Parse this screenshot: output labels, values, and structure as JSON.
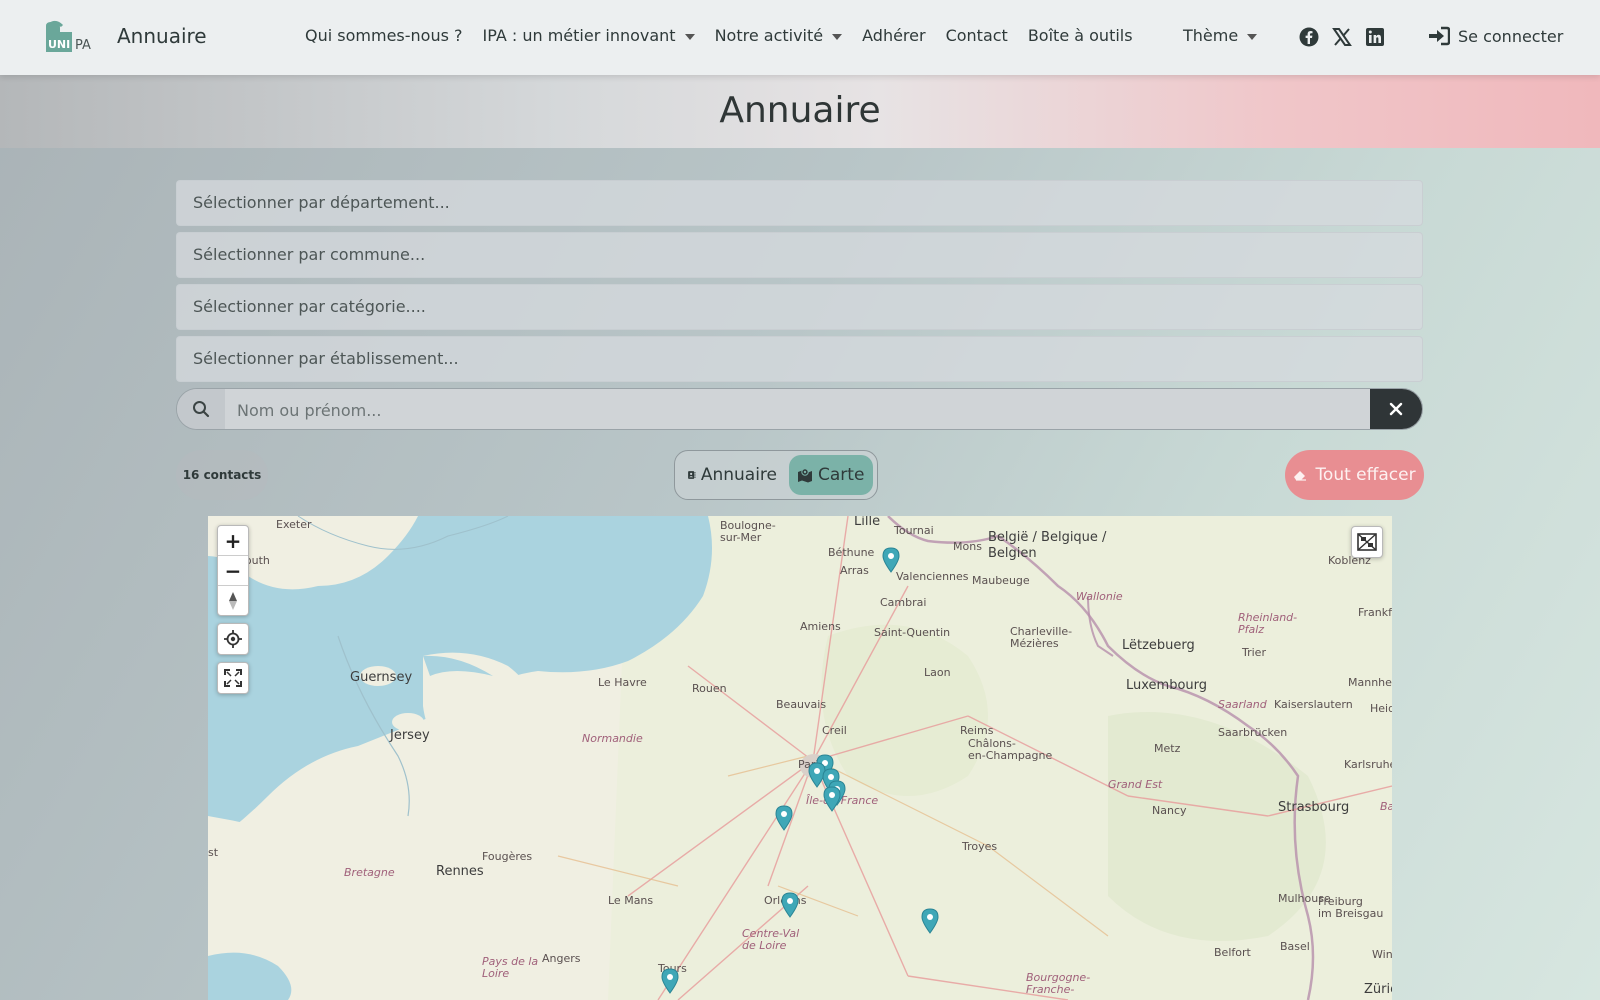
{
  "navbar": {
    "logo_text": "UNIPA",
    "brand": "Annuaire",
    "menu": [
      {
        "label": "Qui sommes-nous ?",
        "dropdown": false
      },
      {
        "label": "IPA : un métier innovant",
        "dropdown": true
      },
      {
        "label": "Notre activité",
        "dropdown": true
      },
      {
        "label": "Adhérer",
        "dropdown": false
      },
      {
        "label": "Contact",
        "dropdown": false
      },
      {
        "label": "Boîte à outils",
        "dropdown": false
      }
    ],
    "theme_label": "Thème",
    "socials": [
      "facebook-icon",
      "x-icon",
      "linkedin-icon"
    ],
    "login_label": "Se connecter"
  },
  "page": {
    "title": "Annuaire"
  },
  "filters": {
    "departement": "Sélectionner par département...",
    "commune": "Sélectionner par commune...",
    "categorie": "Sélectionner par catégorie....",
    "etablissement": "Sélectionner par établissement..."
  },
  "search": {
    "placeholder": "Nom ou prénom...",
    "value": ""
  },
  "controls": {
    "count": "16 contacts",
    "view_annuaire": "Annuaire",
    "view_carte": "Carte",
    "active_view": "Carte",
    "clear_all": "Tout effacer"
  },
  "map": {
    "labels": {
      "exeter": "Exeter",
      "plymouth": "Plymouth",
      "boulogne": "Boulogne-\nsur-Mer",
      "lille": "Lille",
      "tournai": "Tournai",
      "belgique": "België / Belgique /\nBelgien",
      "mons": "Mons",
      "bethune": "Béthune",
      "arras": "Arras",
      "valenciennes": "Valenciennes",
      "maubeuge": "Maubeuge",
      "koblenz": "Koblenz",
      "wallonie": "Wallonie",
      "cambrai": "Cambrai",
      "amiens": "Amiens",
      "saint_quentin": "Saint-Quentin",
      "charleville": "Charleville-\nMézières",
      "letzebuerg": "Lëtzebuerg",
      "trier": "Trier",
      "rheinland": "Rheinland-\nPfalz",
      "frankfurt": "Frankf",
      "guernsey": "Guernsey",
      "le_havre": "Le Havre",
      "rouen": "Rouen",
      "laon": "Laon",
      "luxembourg": "Luxembourg",
      "mannheim": "Mannheim",
      "kaiserslautern": "Kaiserslautern",
      "heidelberg": "Heide",
      "saarland": "Saarland",
      "saarbrucken": "Saarbrücken",
      "jersey": "Jersey",
      "normandie": "Normandie",
      "beauvais": "Beauvais",
      "creil": "Creil",
      "reims": "Reims",
      "chalons": "Châlons-\nen-Champagne",
      "metz": "Metz",
      "karlsruhe": "Karlsruhe",
      "paris": "Paris",
      "ile_de_france": "Île-de-France",
      "grand_est": "Grand Est",
      "nancy": "Nancy",
      "strasbourg": "Strasbourg",
      "ba": "Ba",
      "troyes": "Troyes",
      "fougeres": "Fougères",
      "bretagne": "Bretagne",
      "rennes": "Rennes",
      "le_mans": "Le Mans",
      "orleans": "Orléans",
      "freiburg": "Freiburg\nim Breisgau",
      "mulhouse": "Mulhouse",
      "centre": "Centre-Val\nde Loire",
      "belfort": "Belfort",
      "basel": "Basel",
      "winterthur": "Wint",
      "pays_loire": "Pays de la\nLoire",
      "angers": "Angers",
      "tours": "Tours",
      "bourgogne": "Bourgogne-\nFranche-",
      "zurich": "Züric",
      "brest": "st"
    },
    "markers_count": 10,
    "accent_marker": "#3fa7b7"
  },
  "colors": {
    "accent": "#7bb2a8",
    "danger": "#e88e92",
    "dark": "#2f3537"
  }
}
